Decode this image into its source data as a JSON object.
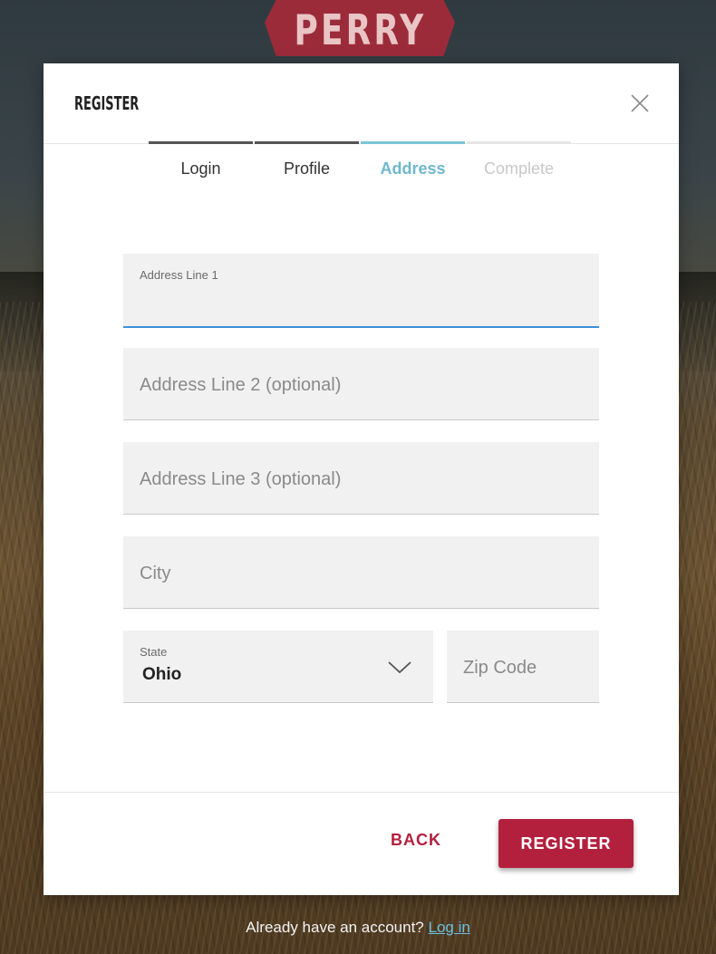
{
  "logo": {
    "text": "PERRY"
  },
  "modal": {
    "title": "REGISTER",
    "close_icon": "close-icon"
  },
  "steps": [
    {
      "label": "Login",
      "state": "done"
    },
    {
      "label": "Profile",
      "state": "done"
    },
    {
      "label": "Address",
      "state": "active"
    },
    {
      "label": "Complete",
      "state": "todo"
    }
  ],
  "form": {
    "address1": {
      "label": "Address Line 1",
      "value": ""
    },
    "address2": {
      "placeholder": "Address Line 2 (optional)"
    },
    "address3": {
      "placeholder": "Address Line 3 (optional)"
    },
    "city": {
      "placeholder": "City"
    },
    "state": {
      "label": "State",
      "value": "Ohio",
      "icon": "chevron-down-icon"
    },
    "zip": {
      "placeholder": "Zip Code"
    }
  },
  "footer": {
    "back_label": "BACK",
    "register_label": "REGISTER"
  },
  "bottom": {
    "prompt": "Already have an account?",
    "login_link": "Log in"
  },
  "colors": {
    "accent": "#b3203e",
    "active_step": "#6fb8cc",
    "focus_underline": "#3d8fd6"
  }
}
